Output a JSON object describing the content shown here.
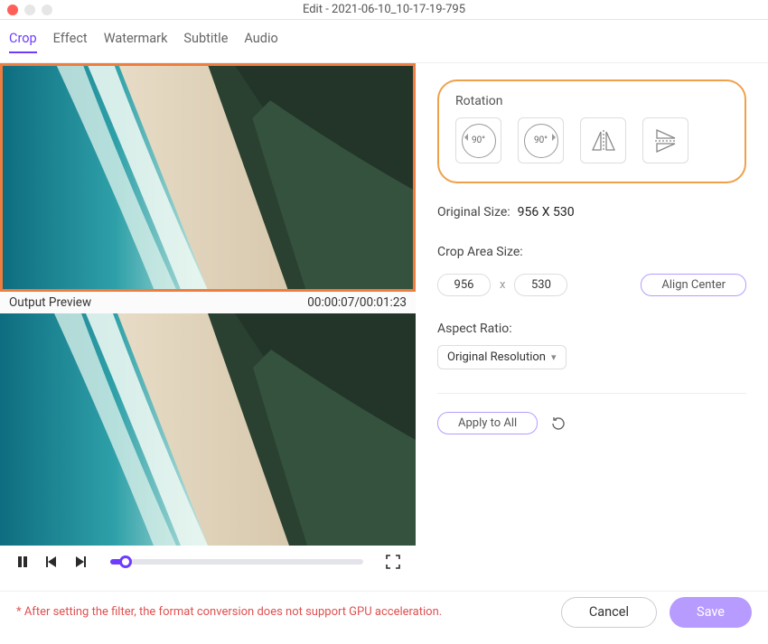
{
  "titlebar": {
    "title": "Edit - 2021-06-10_10-17-19-795"
  },
  "tabs": {
    "items": [
      "Crop",
      "Effect",
      "Watermark",
      "Subtitle",
      "Audio"
    ],
    "active": "Crop"
  },
  "preview": {
    "label": "Output Preview",
    "timecode": "00:00:07/00:01:23"
  },
  "rotation": {
    "label": "Rotation",
    "ccw_label": "90°",
    "cw_label": "90°"
  },
  "original_size": {
    "label": "Original Size:",
    "value": "956 X 530"
  },
  "crop_area": {
    "label": "Crop Area Size:",
    "width": "956",
    "height": "530",
    "x_sep": "x",
    "align_center": "Align Center"
  },
  "aspect": {
    "label": "Aspect Ratio:",
    "selected": "Original Resolution"
  },
  "apply_all": "Apply to All",
  "footer": {
    "warning": "* After setting the filter, the format conversion does not support GPU acceleration.",
    "cancel": "Cancel",
    "save": "Save"
  }
}
